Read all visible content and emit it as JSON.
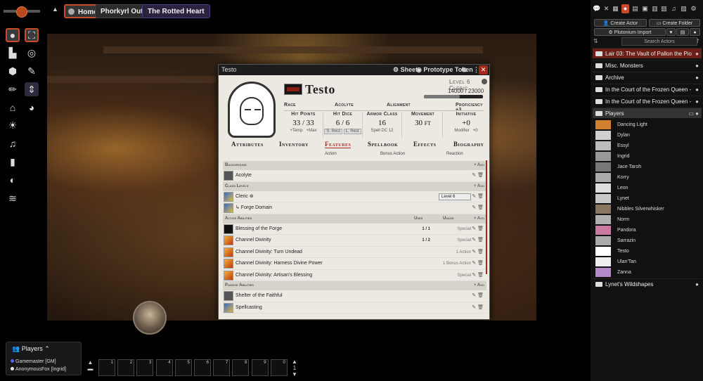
{
  "scene_nav": {
    "collapse_glyph": "▲",
    "scenes": [
      {
        "label": "Home",
        "active": true
      },
      {
        "label": "Phorkyrl Outpost"
      },
      {
        "label": "The Rotted Heart"
      }
    ]
  },
  "left_controls": {
    "icons": [
      "token-controls-icon",
      "fullscreen-target-icon",
      "ruler-icon",
      "target-icon",
      "shapes-icon",
      "tape-icon",
      "pencil-icon",
      "sort-arrows-icon",
      "bank-icon",
      "palette-icon",
      "lightbulb-icon",
      "music-icon",
      "bookmark-icon",
      "paint-icon",
      "layers-icon"
    ]
  },
  "sheet": {
    "window_title": "Testo",
    "header_sheet": "Sheet",
    "header_token": "Prototype Token",
    "name": "Testo",
    "level": "Level 6 Cleric",
    "xp_current": "14000",
    "xp_max": "23000",
    "xp_fraction": 0.61,
    "info": {
      "race_label": "Race",
      "background_label": "Acolyte",
      "alignment_label": "Alignment",
      "proficiency": "Proficiency +3"
    },
    "stats": {
      "hp_label": "Hit Points",
      "hp_cur": "33",
      "hp_sep": "/",
      "hp_max": "33",
      "hp_temp": "+Temp",
      "hp_maxmod": "+Max",
      "hd_label": "Hit Dice",
      "hd_cur": "6",
      "hd_sep": "/",
      "hd_max": "6",
      "hd_srest": "S. Rest",
      "hd_lrest": "L. Rest",
      "ac_label": "Armor Class",
      "ac_val": "16",
      "ac_sub": "Spell DC 12",
      "mv_label": "Movement",
      "mv_val": "30 ft",
      "init_label": "Initiative",
      "init_val": "+0",
      "init_sub": "Modifier",
      "init_mod": "+0"
    },
    "tabs": [
      "Attributes",
      "Inventory",
      "Features",
      "Spellbook",
      "Effects",
      "Biography"
    ],
    "tab_subs": [
      "Action",
      "Bonus Action",
      "Reaction"
    ],
    "sections": {
      "background": {
        "label": "Background",
        "add": "+ Add",
        "item": "Acolyte"
      },
      "class_levels": {
        "label": "Class Levels",
        "add": "+ Add",
        "cleric": "Cleric",
        "cleric_level": "Level 6",
        "subclass": "↳ Forge Domain"
      },
      "active": {
        "label": "Active Abilities",
        "uses_header": "Uses",
        "usage_header": "Usage",
        "add": "+ Add",
        "items": [
          {
            "name": "Blessing of the Forge",
            "uses": "1",
            "of": "/ 1",
            "usage": "Special"
          },
          {
            "name": "Channel Divinity",
            "uses": "1",
            "of": "/ 2",
            "usage": "Special"
          },
          {
            "name": "Channel Divinity: Turn Undead",
            "uses": "",
            "of": "",
            "usage": "1 Action"
          },
          {
            "name": "Channel Divinity: Harness Divine Power",
            "uses": "",
            "of": "",
            "usage": "1 Bonus Action"
          },
          {
            "name": "Channel Divinity: Artisan's Blessing",
            "uses": "",
            "of": "",
            "usage": "Special"
          }
        ]
      },
      "passive": {
        "label": "Passive Abilities",
        "add": "+ Add",
        "items": [
          "Shelter of the Faithful",
          "Spellcasting"
        ]
      }
    }
  },
  "sidebar": {
    "create_actor": "Create Actor",
    "create_folder": "Create Folder",
    "plutonium_import": "Plutonium Import",
    "search_placeholder": "Search Actors",
    "folders": [
      "Lair 03: The Vault of Pallon the Pio",
      "Misc. Monsters",
      "Archive",
      "In the Court of the Frozen Queen -",
      "In the Court of the Frozen Queen -",
      "Players"
    ],
    "players": [
      "Dancing Light",
      "Dylan",
      "Essyl",
      "Ingrid",
      "Jace Taroh",
      "Korry",
      "Leon",
      "Lynet",
      "Nibbles Silverwhisker",
      "Norm",
      "Pandora",
      "Sarrazin",
      "Testo",
      "Ulan'Tan",
      "Zanna"
    ],
    "last_folder": "Lynet's Wildshapes",
    "notification_count": "1"
  },
  "players_panel": {
    "title": "Players",
    "entries": [
      {
        "name": "Gamemaster [GM]",
        "color": "#5865f2"
      },
      {
        "name": "AnonymousFox [Ingrid]",
        "color": "#e8e8e8"
      }
    ]
  },
  "hotbar": {
    "slots": [
      "1",
      "2",
      "3",
      "4",
      "5",
      "6",
      "7",
      "8",
      "9",
      "0"
    ],
    "page": "1"
  }
}
